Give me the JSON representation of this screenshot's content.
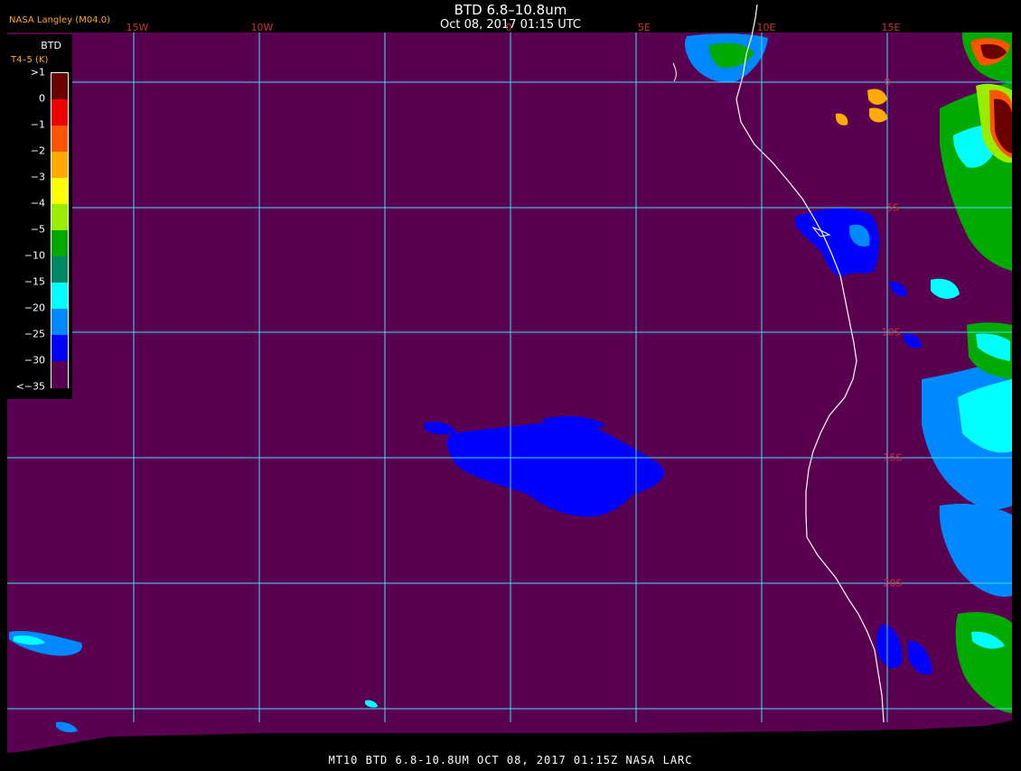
{
  "header": {
    "title": "BTD 6.8–10.8um",
    "subtitle": "Oct 08, 2017 01:15 UTC",
    "agency": "NASA Langley (M04.0)"
  },
  "footer": "MT10  BTD 6.8-10.8UM  OCT 08, 2017 01:15Z  NASA LARC",
  "longitude_labels": [
    "15W",
    "10W",
    "0",
    "5E",
    "10E",
    "15E"
  ],
  "latitude_labels": [
    "0",
    "5S",
    "10S",
    "15S",
    "20S"
  ],
  "legend": {
    "title": "BTD",
    "subtitle": "T4–5 (K)",
    "ticks": [
      ">1",
      "0",
      "−1",
      "−2",
      "−3",
      "−4",
      "−5",
      "−10",
      "−15",
      "−20",
      "−25",
      "−30",
      "<−35"
    ],
    "colors": [
      "#6b0000",
      "#ee0000",
      "#ff5500",
      "#ffaa00",
      "#ffff00",
      "#99ee00",
      "#00aa00",
      "#008866",
      "#00ffff",
      "#0088ff",
      "#0000ff",
      "#5a0050"
    ]
  },
  "colors": {
    "ocean_background": "#5a0050",
    "grid": "#44ddff",
    "coast": "#ffffff",
    "label_red": "#cc3333"
  }
}
